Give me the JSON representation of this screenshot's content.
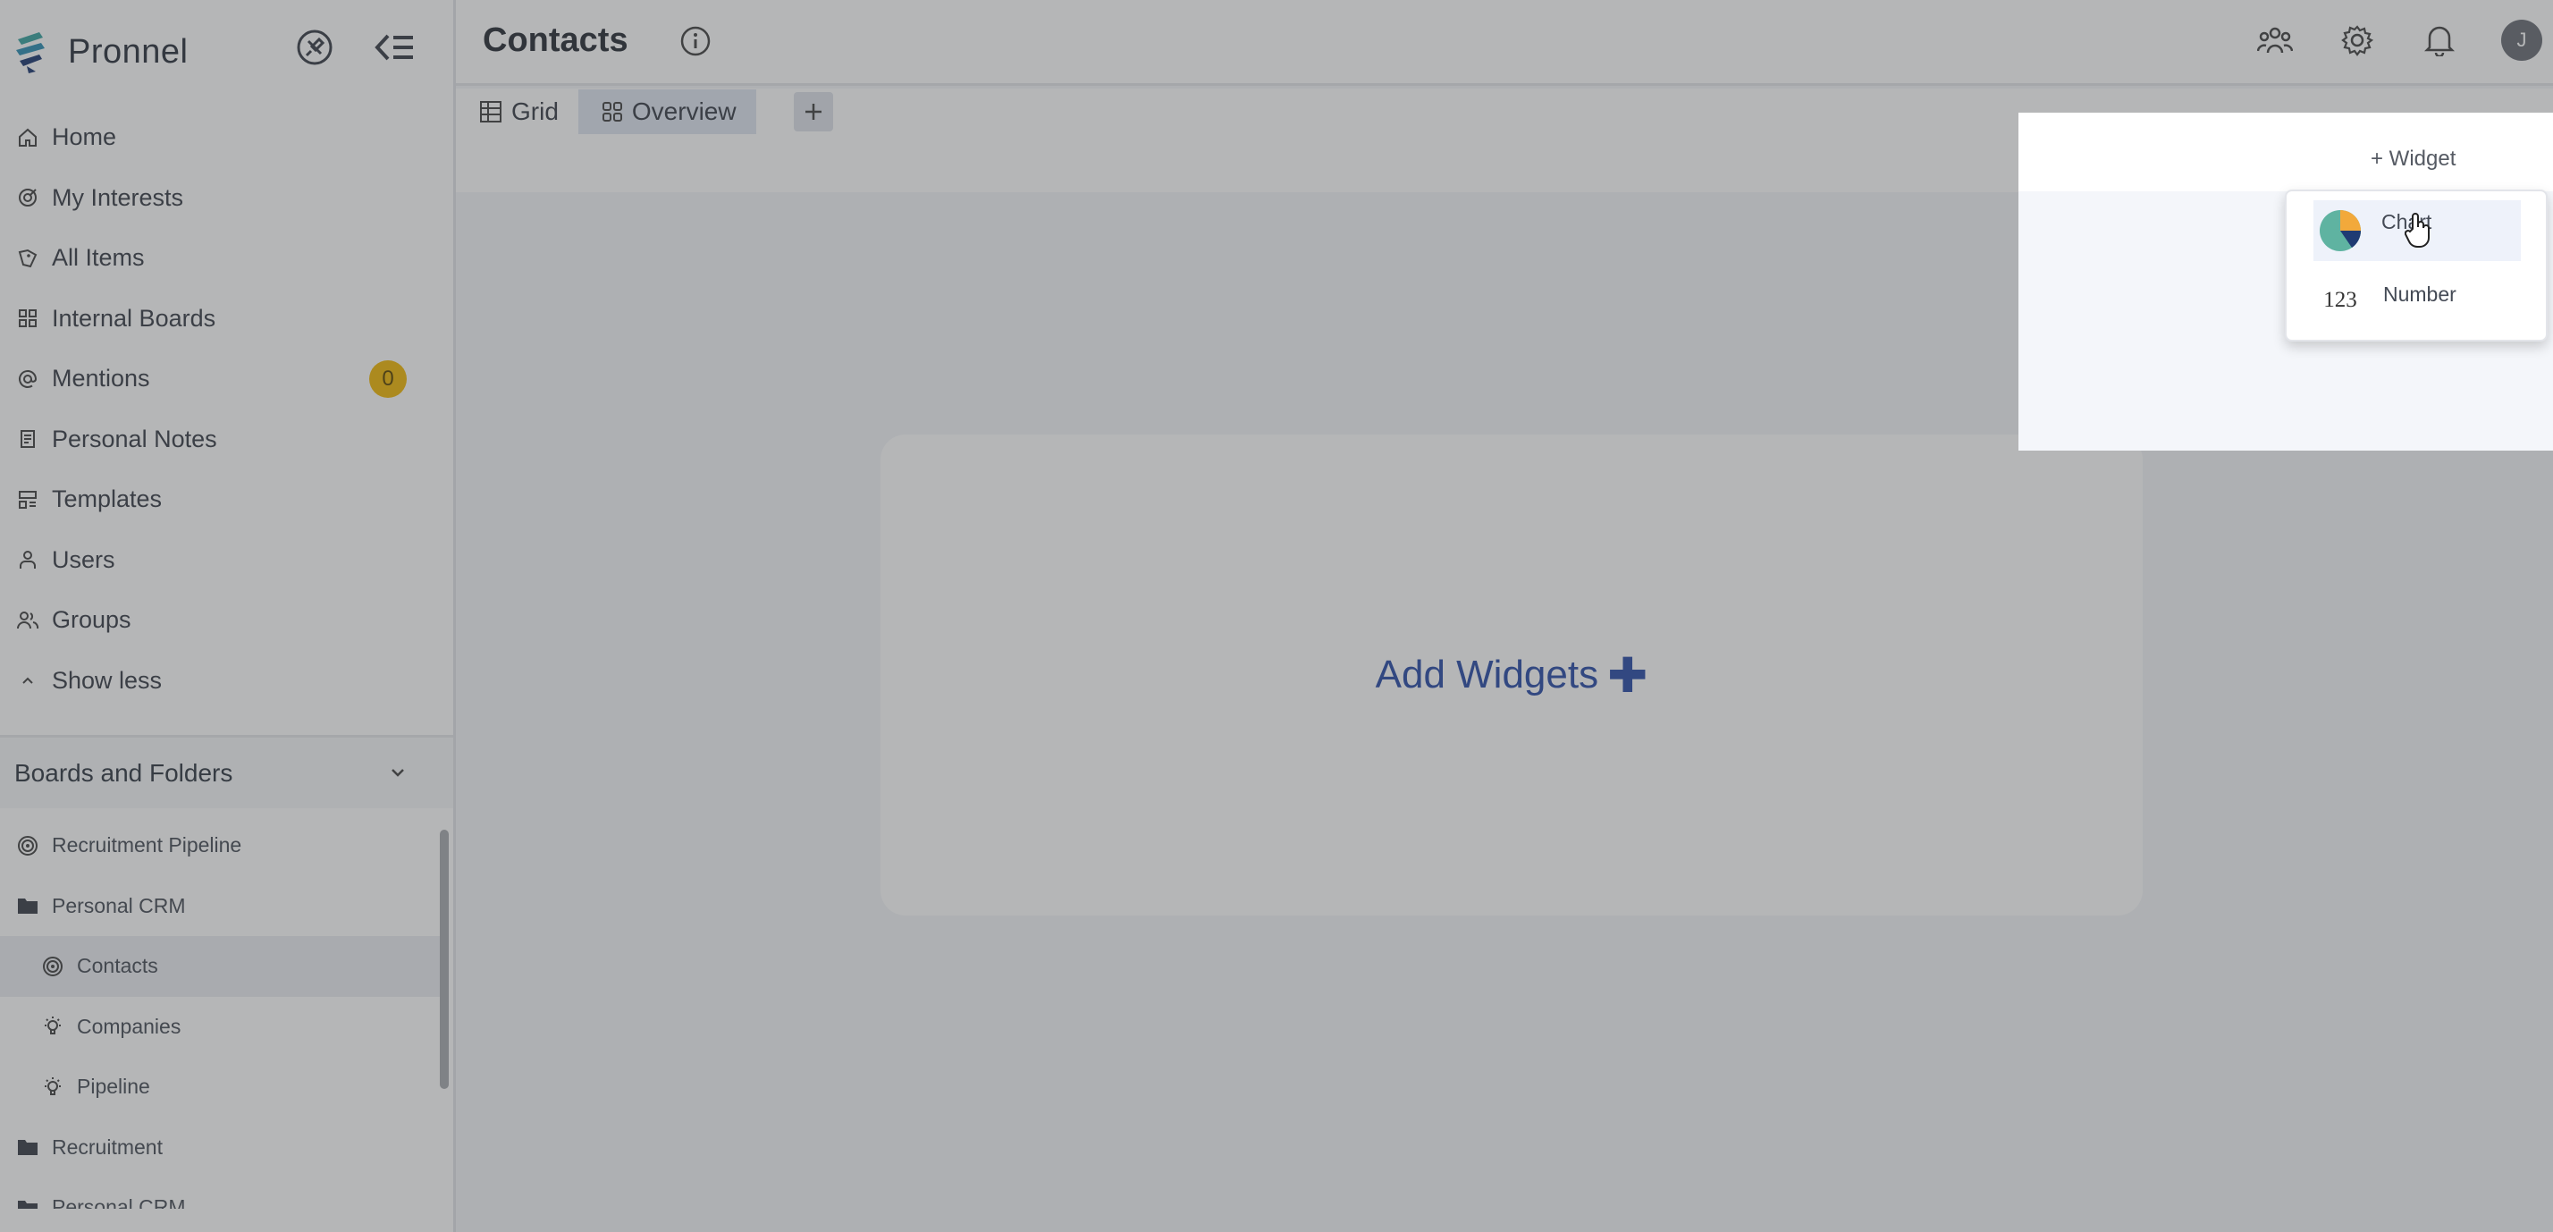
{
  "brand": {
    "name": "Pronnel"
  },
  "sidebar": {
    "nav": [
      {
        "label": "Home",
        "icon": "home-icon"
      },
      {
        "label": "My Interests",
        "icon": "target-icon"
      },
      {
        "label": "All Items",
        "icon": "tag-icon"
      },
      {
        "label": "Internal Boards",
        "icon": "boards-icon"
      },
      {
        "label": "Mentions",
        "icon": "at-icon",
        "badge": "0"
      },
      {
        "label": "Personal Notes",
        "icon": "notes-icon"
      },
      {
        "label": "Templates",
        "icon": "templates-icon"
      },
      {
        "label": "Users",
        "icon": "user-icon"
      },
      {
        "label": "Groups",
        "icon": "group-icon"
      },
      {
        "label": "Show less",
        "icon": "chevron-up-icon"
      }
    ],
    "section_title": "Boards and Folders",
    "tree": [
      {
        "label": "Recruitment Pipeline",
        "icon": "target-icon",
        "level": 0
      },
      {
        "label": "Personal CRM",
        "icon": "folder-icon",
        "level": 0
      },
      {
        "label": "Contacts",
        "icon": "target-icon",
        "level": 1,
        "selected": true
      },
      {
        "label": "Companies",
        "icon": "bulb-icon",
        "level": 1
      },
      {
        "label": "Pipeline",
        "icon": "bulb-icon",
        "level": 1
      },
      {
        "label": "Recruitment",
        "icon": "folder-icon",
        "level": 0
      },
      {
        "label": "Personal CRM",
        "icon": "folder-icon",
        "level": 0
      }
    ]
  },
  "header": {
    "title": "Contacts",
    "avatar_initial": "J"
  },
  "tabs": [
    {
      "label": "Grid",
      "icon": "grid-icon",
      "active": false
    },
    {
      "label": "Overview",
      "icon": "overview-icon",
      "active": true
    }
  ],
  "content": {
    "add_widgets_label": "Add Widgets",
    "add_widgets_plus": "✚"
  },
  "widget_menu": {
    "button_label": "+ Widget",
    "items": [
      {
        "label": "Chart",
        "icon": "pie-chart-icon"
      },
      {
        "label": "Number",
        "glyph": "123"
      }
    ]
  },
  "colors": {
    "accent": "#2d4ea8",
    "badge": "#f0b90b",
    "pie_teal": "#5fb3a1",
    "pie_orange": "#f2a93b",
    "pie_navy": "#1f3b73"
  }
}
